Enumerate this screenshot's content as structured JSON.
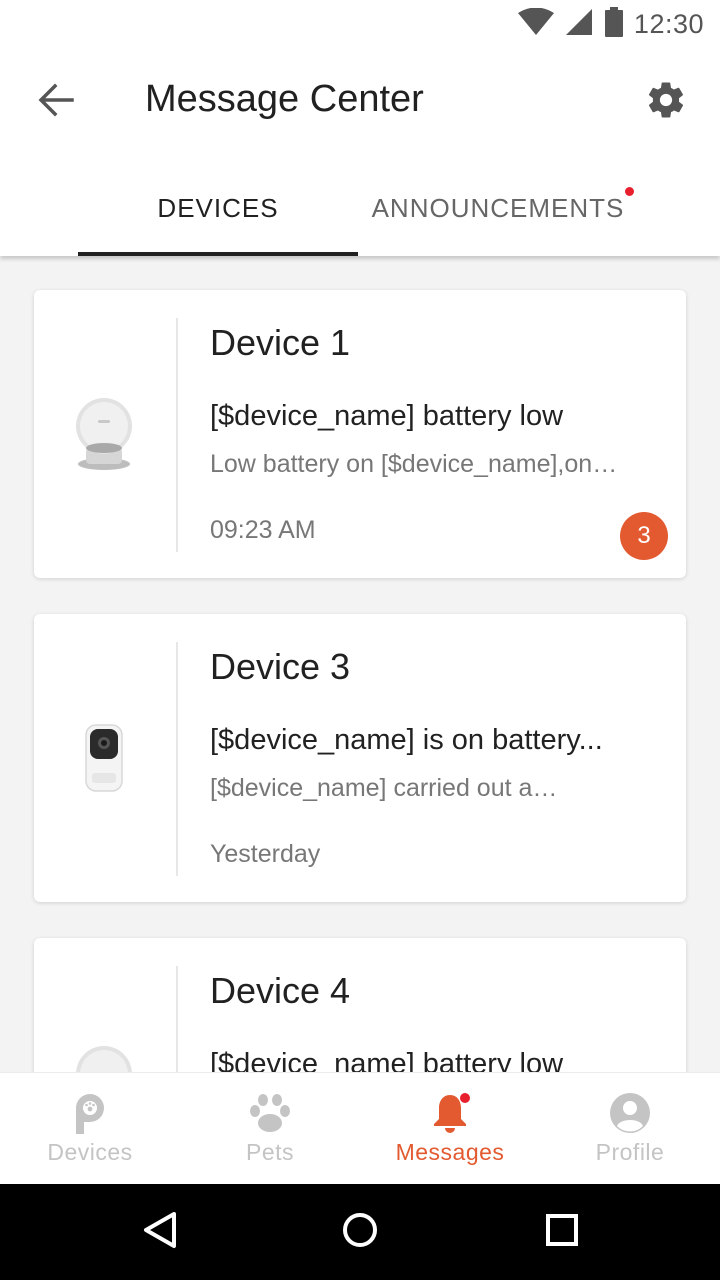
{
  "status_bar": {
    "time": "12:30",
    "icons": [
      "wifi-icon",
      "signal-icon",
      "battery-icon"
    ]
  },
  "header": {
    "title": "Message Center",
    "back_icon": "back-arrow-icon",
    "settings_icon": "gear-icon"
  },
  "tabs": [
    {
      "label": "DEVICES",
      "active": true
    },
    {
      "label": "ANNOUNCEMENTS",
      "active": false,
      "has_new_dot": true
    }
  ],
  "messages": [
    {
      "device_name": "Device 1",
      "subject": "[$device_name] battery low",
      "preview": "Low battery on [$device_name],on…",
      "time": "09:23 AM",
      "unread_count": "3",
      "thumbnail": "pet-feeder-image"
    },
    {
      "device_name": "Device 3",
      "subject": "[$device_name] is on battery...",
      "preview": "[$device_name] carried out a…",
      "time": "Yesterday",
      "thumbnail": "pet-camera-image"
    },
    {
      "device_name": "Device 4",
      "subject": "[$device_name] battery low",
      "thumbnail": "pet-feeder-image"
    }
  ],
  "bottom_nav": [
    {
      "label": "Devices",
      "icon": "petkit-logo-icon",
      "active": false
    },
    {
      "label": "Pets",
      "icon": "paw-icon",
      "active": false
    },
    {
      "label": "Messages",
      "icon": "bell-icon",
      "active": true,
      "has_new_dot": true
    },
    {
      "label": "Profile",
      "icon": "user-icon",
      "active": false
    }
  ],
  "colors": {
    "accent": "#e35a30",
    "notification_dot": "#e8202e",
    "inactive_nav": "#c4c4c4"
  }
}
